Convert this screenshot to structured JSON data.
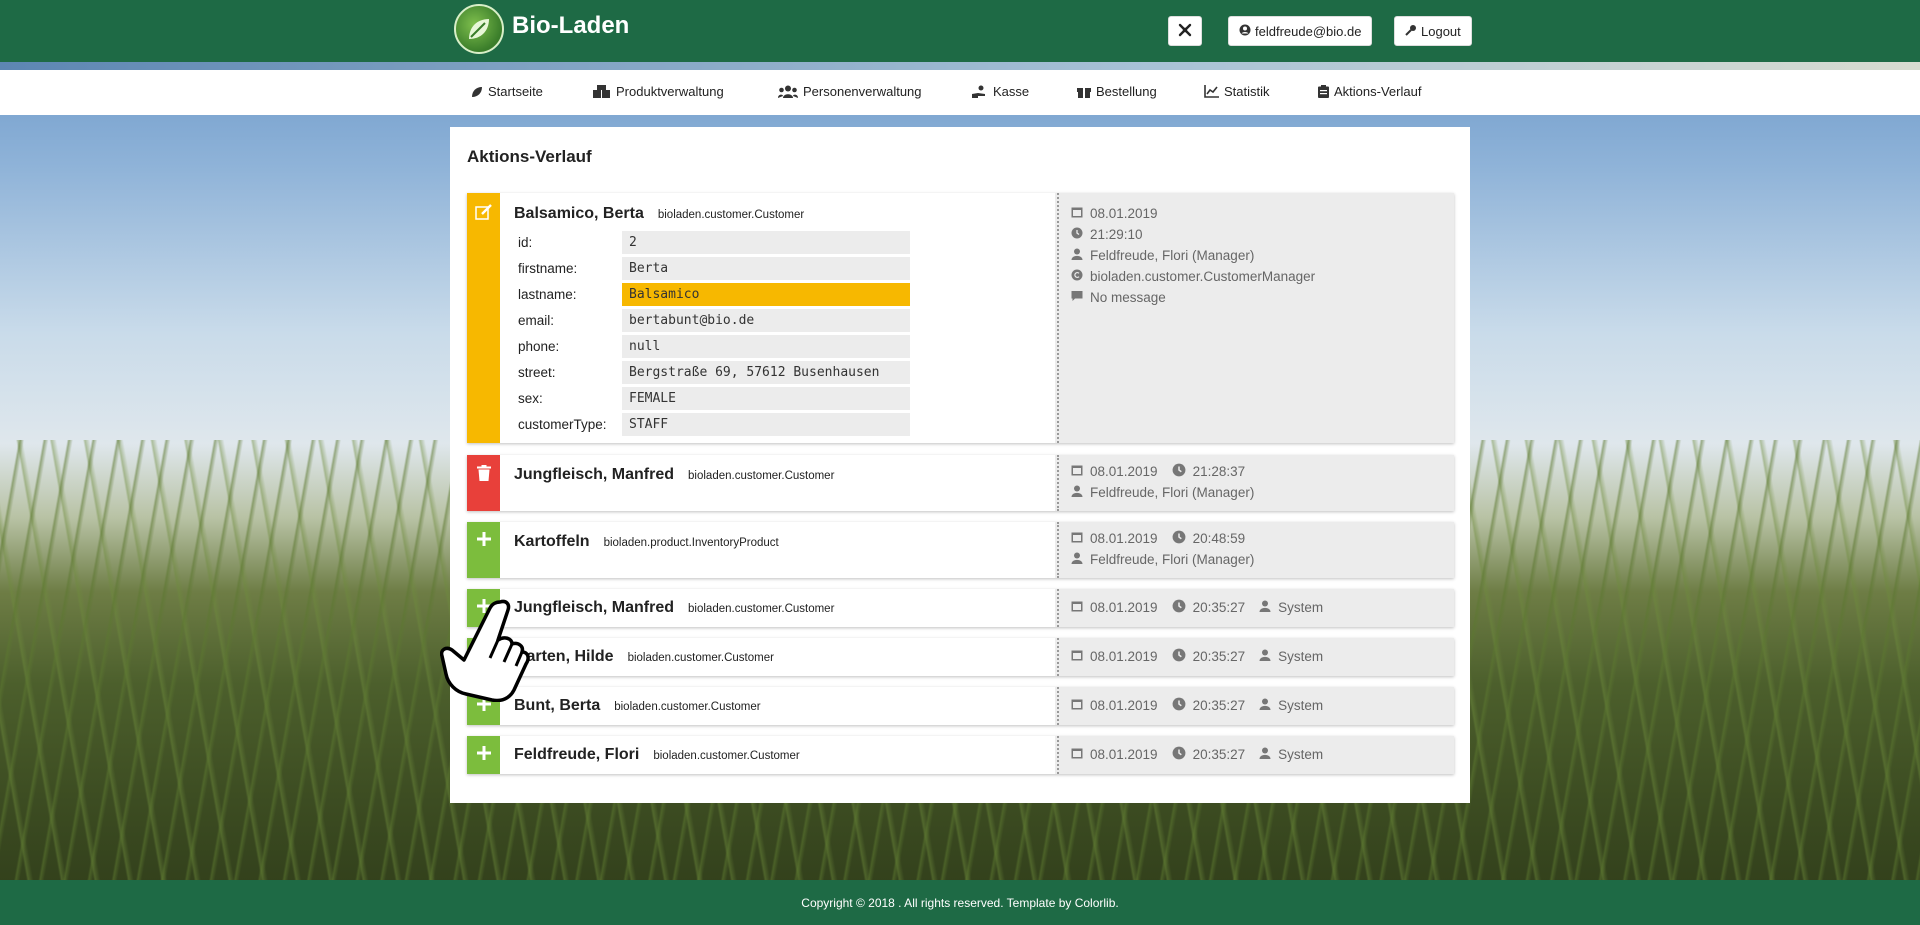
{
  "header": {
    "brand": "Bio-Laden",
    "user_label": "feldfreude@bio.de",
    "logout_label": "Logout"
  },
  "nav": {
    "items": [
      {
        "label": "Startseite",
        "icon": "leaf-icon"
      },
      {
        "label": "Produktverwaltung",
        "icon": "boxes-icon"
      },
      {
        "label": "Personenverwaltung",
        "icon": "users-icon"
      },
      {
        "label": "Kasse",
        "icon": "hand-coin-icon"
      },
      {
        "label": "Bestellung",
        "icon": "gift-icon"
      },
      {
        "label": "Statistik",
        "icon": "chart-icon"
      },
      {
        "label": "Aktions-Verlauf",
        "icon": "clipboard-icon"
      }
    ]
  },
  "page": {
    "title": "Aktions-Verlauf"
  },
  "entries": [
    {
      "action": "edit",
      "color": "#f7b800",
      "name": "Balsamico, Berta",
      "type": "bioladen.customer.Customer",
      "fields": [
        {
          "label": "id:",
          "value": "2"
        },
        {
          "label": "firstname:",
          "value": "Berta"
        },
        {
          "label": "lastname:",
          "value": "Balsamico",
          "highlight": true
        },
        {
          "label": "email:",
          "value": "bertabunt@bio.de"
        },
        {
          "label": "phone:",
          "value": "null"
        },
        {
          "label": "street:",
          "value": "Bergstraße 69, 57612 Busenhausen"
        },
        {
          "label": "sex:",
          "value": "FEMALE"
        },
        {
          "label": "customerType:",
          "value": "STAFF"
        }
      ],
      "date": "08.01.2019",
      "time": "21:29:10",
      "user": "Feldfreude, Flori (Manager)",
      "source": "bioladen.customer.CustomerManager",
      "message": "No message"
    },
    {
      "action": "delete",
      "color": "#e8403a",
      "name": "Jungfleisch, Manfred",
      "type": "bioladen.customer.Customer",
      "date": "08.01.2019",
      "time": "21:28:37",
      "user": "Feldfreude, Flori (Manager)"
    },
    {
      "action": "add",
      "color": "#7cbd3d",
      "name": "Kartoffeln",
      "type": "bioladen.product.InventoryProduct",
      "date": "08.01.2019",
      "time": "20:48:59",
      "user": "Feldfreude, Flori (Manager)"
    },
    {
      "action": "add",
      "color": "#7cbd3d",
      "name": "Jungfleisch, Manfred",
      "type": "bioladen.customer.Customer",
      "date": "08.01.2019",
      "time": "20:35:27",
      "user": "System"
    },
    {
      "action": "add",
      "color": "#7cbd3d",
      "name": "Garten, Hilde",
      "type": "bioladen.customer.Customer",
      "date": "08.01.2019",
      "time": "20:35:27",
      "user": "System"
    },
    {
      "action": "add",
      "color": "#7cbd3d",
      "name": "Bunt, Berta",
      "type": "bioladen.customer.Customer",
      "date": "08.01.2019",
      "time": "20:35:27",
      "user": "System"
    },
    {
      "action": "add",
      "color": "#7cbd3d",
      "name": "Feldfreude, Flori",
      "type": "bioladen.customer.Customer",
      "date": "08.01.2019",
      "time": "20:35:27",
      "user": "System"
    }
  ],
  "footer": {
    "text": "Copyright © 2018 . All rights reserved. Template by Colorlib."
  },
  "colors": {
    "header": "#1e6a45",
    "edit": "#f7b800",
    "delete": "#e8403a",
    "add": "#7cbd3d"
  }
}
